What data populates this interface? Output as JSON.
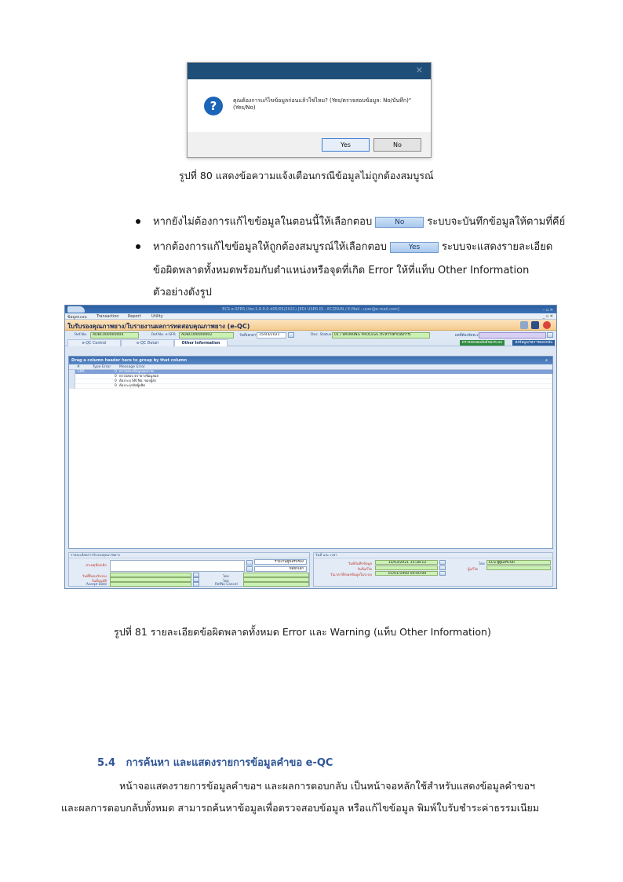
{
  "figure80": {
    "dialog": {
      "close_glyph": "✕",
      "message_line1": "คุณต้องการแก้ไขข้อมูลก่อนแล้วใช่ไหม? (Yes/ตรวจสอบข้อมูล: No/บันทึก)\"",
      "message_line2": "(Yes/No)",
      "yes_label": "Yes",
      "no_label": "No"
    },
    "caption": "รูปที่ 80 แสดงข้อความแจ้งเตือนกรณีข้อมูลไม่ถูกต้องสมบูรณ์"
  },
  "bullets": [
    {
      "before": "หากยังไม่ต้องการแก้ไขข้อมูลในตอนนี้ให้เลือกตอบ",
      "button": "No",
      "after": "ระบบจะบันทึกข้อมูลให้ตามที่คีย์"
    },
    {
      "before": "หากต้องการแก้ไขข้อมูลให้ถูกต้องสมบูรณ์ให้เลือกตอบ",
      "button": "Yes",
      "after": "ระบบจะแสดงรายละเอียด",
      "line2": "ข้อผิดพลาดทั้งหมดพร้อมกับตำแหน่งหรือจุดที่เกิด Error ให้ที่แท็บ Other Information",
      "line3": "ตัวอย่างดังรูป"
    }
  ],
  "figure81": {
    "app": {
      "window_title": "ECS e-SFRS (Ver.1.0.0.0 d05/05/2021) [EDI USER ID : ECZNUN / E-Mail : user@e-mail.com]",
      "win_controls": "– ▫ ✕",
      "menu": [
        "ข้อมูลระบบ",
        "Transaction",
        "Report",
        "Utility"
      ],
      "menu_right": "_ ▫ ✕",
      "header_title": "ใบรับรองคุณภาพยาง/ใบรายงานผลการทดสอบคุณภาพยาง (e-QC)",
      "ref_label": "Ref.No.",
      "ref_value": "ADBC000000004",
      "refsfr_label": "Ref.No. e-SFR",
      "refsfr_value": "ADBC000000002",
      "date_label": "วันที่เอกสาร",
      "date_value": "15/03/2021",
      "docstatus_label": "Doc. Status",
      "docstatus_value": "01 / WORKING PROCESS (ระหว่างดำเนินการ)",
      "owner_label": "ผลที่ต้องจัดทะเบียน",
      "tabs": [
        "e-QC Control",
        "e-QC Detail",
        "Other Information"
      ],
      "right_tabs": [
        "ตรวจสอบผลลัพธ์ของระบบ",
        "ส่งข้อมูล/รอการตอบกลับ"
      ],
      "group_bar": "Drag a column header here to group by that column",
      "grid_headers": [
        "#",
        "Type Error",
        "Message Error"
      ],
      "grid_rows": [
        {
          "type": "ERR",
          "no": "0",
          "msg": "ตรวจสอบข้อมูลคุณภาพ"
        },
        {
          "type": "",
          "no": "0",
          "msg": "ตรวจสอบ ตรายางข้อมูลผล"
        },
        {
          "type": "",
          "no": "0",
          "msg": "ต้องระบุ SN No. ของผู้ส่ง"
        },
        {
          "type": "",
          "no": "0",
          "msg": "ต้องระบุรหัสผู้ผลิต"
        }
      ],
      "left_panel": {
        "title": "รายละเอียดการรับรองคุณภาพยาง",
        "reason_label": "สาเหตุที่ยกเลิก",
        "btn_print": "รายงานผู้ขอรับรอง",
        "btn_cancel": "ขอยกเลิก",
        "submit_label": "วันที่ยื่นขอรับรอง",
        "approve_label": "วันที่อนุมัติ",
        "accept_label": "Accept Date",
        "by_label1": "โดย",
        "by_label2": "โดย",
        "refcancel_label": "RefNo Cancel"
      },
      "right_panel": {
        "title": "วันที่ และ เวลา",
        "created_label": "วันที่บันทึกข้อมูล",
        "created_value": "15/03/2021 15:38:12",
        "updated_label": "วันที่แก้ไข",
        "edi_label": "วันเวลาที่ส่งผลข้อมูลในระบบ",
        "edi_value": "01/01/1900 00:00:00",
        "by_label": "โดย",
        "by_value": "ECS ผู้ดูแลระบบ",
        "editor_label": "ผู้แก้ไข"
      }
    },
    "caption": "รูปที่ 81 รายละเอียดข้อผิดพลาดทั้งหมด Error และ Warning (แท็บ Other Information)"
  },
  "section": {
    "number": "5.4",
    "title": "การค้นหา และแสดงรายการข้อมูลคำขอ e-QC",
    "para_line1": "หน้าจอแสดงรายการข้อมูลคำขอฯ และผลการตอบกลับ เป็นหน้าจอหลักใช้สำหรับแสดงข้อมูลคำขอฯ",
    "para_line2": "และผลการตอบกลับทั้งหมด สามารถค้นหาข้อมูลเพื่อตรวจสอบข้อมูล หรือแก้ไขข้อมูล พิมพ์ใบรับชำระค่าธรรมเนียม"
  }
}
